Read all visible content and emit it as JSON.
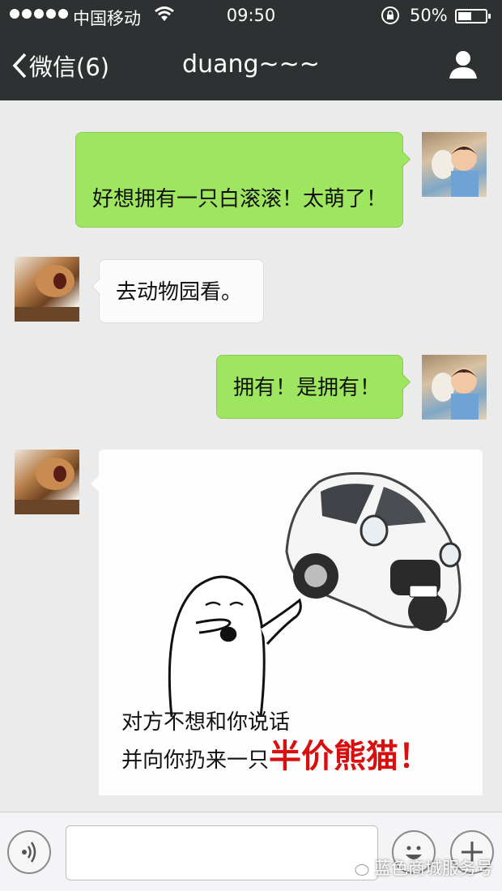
{
  "status_bar": {
    "carrier": "中国移动",
    "time": "09:50",
    "battery": "50%",
    "battery_level": 0.5
  },
  "nav": {
    "back_label": "微信(6)",
    "title": "duang~~~",
    "contact_icon": "person-icon"
  },
  "messages": [
    {
      "direction": "sent",
      "type": "text",
      "text": "好想拥有一只白滚滚！太萌了！"
    },
    {
      "direction": "received",
      "type": "text",
      "text": "去动物园看。"
    },
    {
      "direction": "sent",
      "type": "text",
      "text": "拥有！是拥有！"
    },
    {
      "direction": "received",
      "type": "image",
      "caption_line1": "对方不想和你说话",
      "caption_line2_prefix": "并向你扔来一只",
      "caption_highlight": "半价熊猫！"
    }
  ],
  "input_bar": {
    "voice_icon": "voice-icon",
    "emoji_icon": "emoji-icon",
    "plus_icon": "plus-icon",
    "input_value": ""
  },
  "watermark": {
    "text": "蓝色商城服务号"
  }
}
